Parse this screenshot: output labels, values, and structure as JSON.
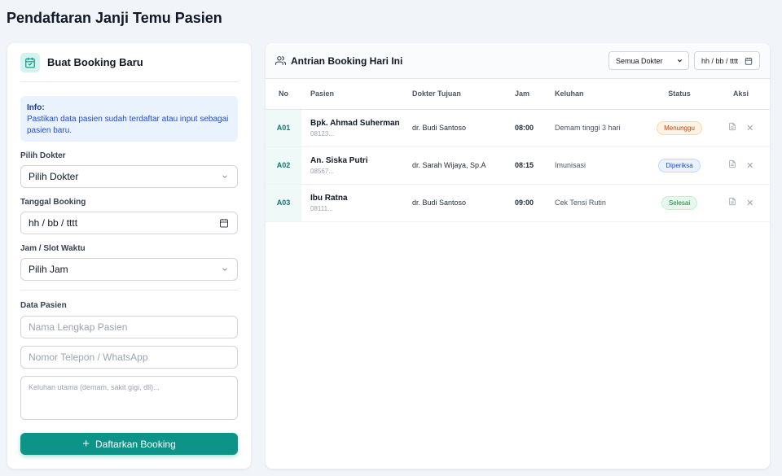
{
  "page": {
    "title": "Pendaftaran Janji Temu Pasien"
  },
  "form": {
    "title": "Buat Booking Baru",
    "info_title": "Info:",
    "info_text": "Pastikan data pasien sudah terdaftar atau input sebagai pasien baru.",
    "doctor_label": "Pilih Dokter",
    "doctor_value": "Pilih Dokter",
    "date_label": "Tanggal Booking",
    "date_value": "hh / bb / tttt",
    "time_label": "Jam / Slot Waktu",
    "time_value": "Pilih Jam",
    "patient_section": "Data Pasien",
    "name_placeholder": "Nama Lengkap Pasien",
    "phone_placeholder": "Nomor Telepon / WhatsApp",
    "complaint_placeholder": "Keluhan utama (demam, sakit gigi, dll)...",
    "submit_label": "Daftarkan Booking"
  },
  "queue": {
    "title": "Antrian Booking Hari Ini",
    "doctor_filter": "Semua Dokter",
    "date_filter": "hh / bb / tttt",
    "columns": [
      "No",
      "Pasien",
      "Dokter Tujuan",
      "Jam",
      "Keluhan",
      "Status",
      "Aksi"
    ],
    "rows": [
      {
        "no": "A01",
        "name": "Bpk. Ahmad Suherman",
        "phone": "08123...",
        "doctor": "dr. Budi Santoso",
        "time": "08:00",
        "complaint": "Demam tinggi 3 hari",
        "status": "Menunggu"
      },
      {
        "no": "A02",
        "name": "An. Siska Putri",
        "phone": "08567...",
        "doctor": "dr. Sarah Wijaya, Sp.A",
        "time": "08:15",
        "complaint": "Imunisasi",
        "status": "Diperiksa"
      },
      {
        "no": "A03",
        "name": "Ibu Ratna",
        "phone": "08111...",
        "doctor": "dr. Budi Santoso",
        "time": "09:00",
        "complaint": "Cek Tensi Rutin",
        "status": "Selesai"
      }
    ]
  },
  "colors": {
    "accent": "#0d9488",
    "waiting": "#c2410c",
    "checking": "#1d4ed8",
    "done": "#15803d"
  }
}
